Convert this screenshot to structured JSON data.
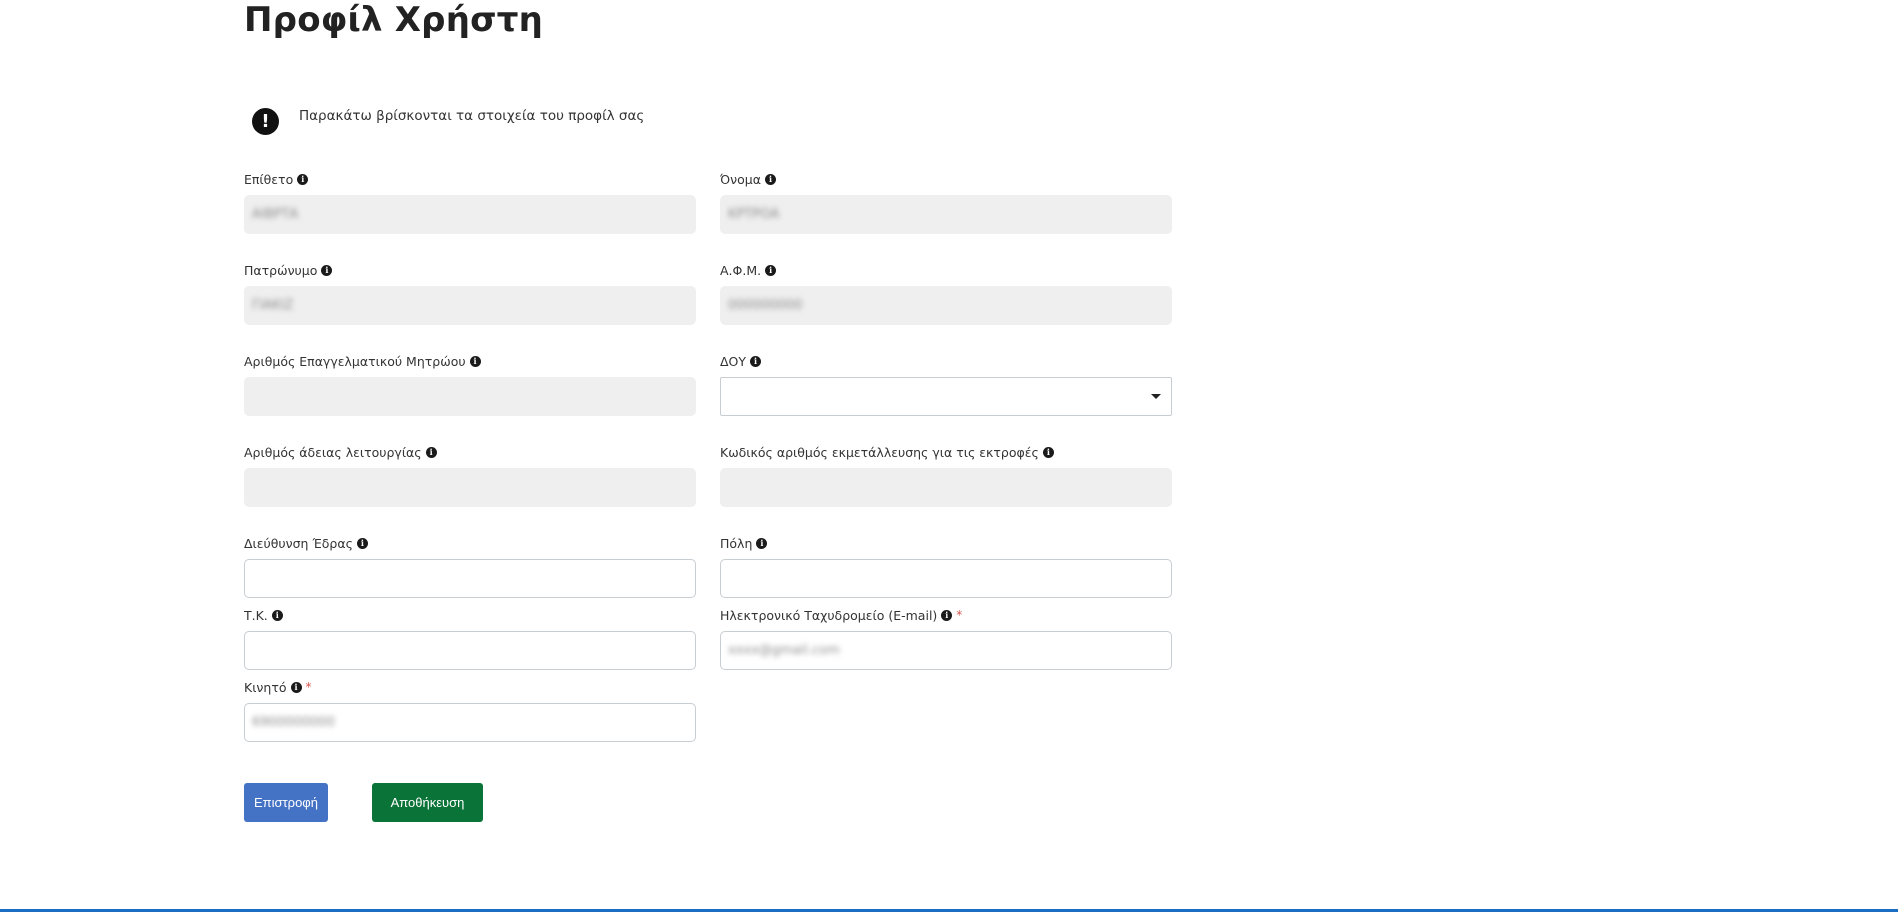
{
  "page": {
    "title": "Προφίλ Χρήστη"
  },
  "notice": {
    "icon": "exclamation-circle-icon",
    "text": "Παρακάτω βρίσκονται τα στοιχεία του προφίλ σας"
  },
  "fields": {
    "last_name": {
      "label": "Επίθετο",
      "value": "ΑΙΒΡΤΑ"
    },
    "first_name": {
      "label": "Όνομα",
      "value": "ΚΡΤΡΟΑ"
    },
    "fathers_name": {
      "label": "Πατρώνυμο",
      "value": "ΓΙΑΚΙΖ"
    },
    "vat_number": {
      "label": "Α.Φ.Μ.",
      "value": "000000000"
    },
    "professional_registry_number": {
      "label": "Αριθμός Επαγγελματικού Μητρώου",
      "value": ""
    },
    "tax_office": {
      "label": "ΔΟΥ",
      "value": ""
    },
    "operating_license_number": {
      "label": "Αριθμός άδειας λειτουργίας",
      "value": ""
    },
    "exploitation_code": {
      "label": "Κωδικός αριθμός εκμετάλλευσης για τις εκτροφές",
      "value": ""
    },
    "address": {
      "label": "Διεύθυνση Έδρας",
      "value": ""
    },
    "city": {
      "label": "Πόλη",
      "value": ""
    },
    "postal_code": {
      "label": "Τ.Κ.",
      "value": ""
    },
    "email": {
      "label": "Ηλεκτρονικό Ταχυδρομείο (E-mail)",
      "value": "xxxx@gmail.com",
      "required": "*"
    },
    "mobile": {
      "label": "Κινητό",
      "value": "6900000000",
      "required": "*"
    }
  },
  "buttons": {
    "back": "Επιστροφή",
    "save": "Αποθήκευση"
  },
  "colors": {
    "back_button": "#4472c4",
    "save_button": "#0a7337",
    "required": "#d9534f",
    "readonly_bg": "#efefef",
    "bottom_line": "#1b6ec2"
  },
  "icons": {
    "info": "info-circle-icon",
    "dropdown": "caret-down-icon"
  }
}
